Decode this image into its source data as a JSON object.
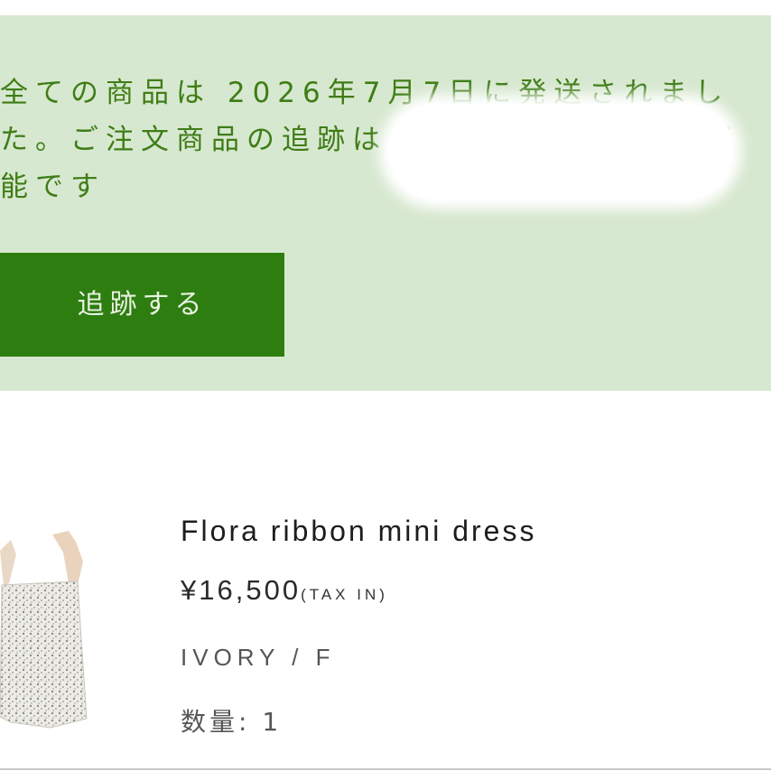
{
  "shipping_notice": {
    "line1": "全ての商品は 2026年7月7日に発送されまし",
    "line2_start": "た。ご注文商品の追跡は",
    "line2_end": "可",
    "line3": "能です",
    "background_color": "#d7e8d0",
    "text_color": "#3f7d16"
  },
  "track_button": {
    "label": "追跡する",
    "color": "#2e7d10"
  },
  "product": {
    "name": "Flora ribbon mini dress",
    "price": "¥16,500",
    "tax_note": "(TAX IN)",
    "variant": "IVORY / F",
    "quantity": "数量: 1",
    "image_icon": "floral-dress-thumbnail"
  }
}
